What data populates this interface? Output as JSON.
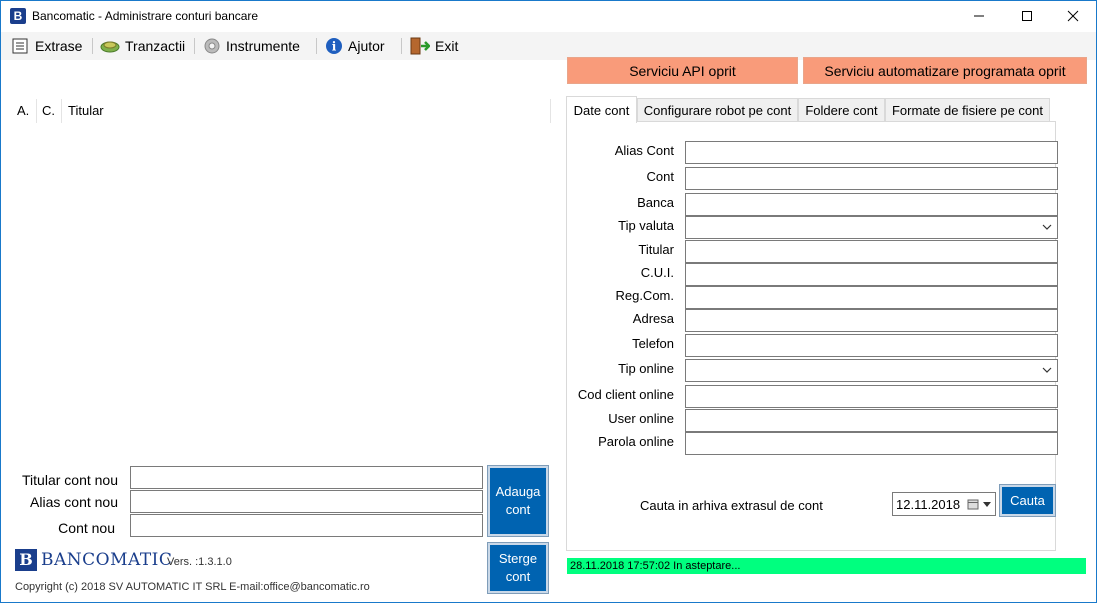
{
  "window": {
    "app_icon_letter": "B",
    "title": "Bancomatic - Administrare conturi bancare"
  },
  "menu": [
    {
      "label": "Extrase",
      "icon": "document-list-icon"
    },
    {
      "label": "Tranzactii",
      "icon": "money-exchange-icon"
    },
    {
      "label": "Instrumente",
      "icon": "gear-icon"
    },
    {
      "label": "Ajutor",
      "icon": "info-icon"
    },
    {
      "label": "Exit",
      "icon": "exit-door-icon"
    }
  ],
  "services": {
    "api": "Serviciu API oprit",
    "automation": "Serviciu automatizare programata oprit",
    "color": "#f99b7a"
  },
  "list_columns": [
    "A.",
    "C.",
    "Titular"
  ],
  "new_account": {
    "holder_label": "Titular cont nou",
    "alias_label": "Alias cont nou",
    "account_label": "Cont nou",
    "holder_value": "",
    "alias_value": "",
    "account_value": "",
    "add_button": "Adauga cont",
    "delete_button": "Sterge cont"
  },
  "tabs": [
    "Date cont",
    "Configurare robot pe cont",
    "Foldere cont",
    "Formate de fisiere pe cont"
  ],
  "fields": [
    {
      "label": "Alias Cont",
      "value": "",
      "type": "text"
    },
    {
      "label": "Cont",
      "value": "",
      "type": "text"
    },
    {
      "label": "Banca",
      "value": "",
      "type": "text"
    },
    {
      "label": "Tip valuta",
      "value": "",
      "type": "combo"
    },
    {
      "label": "Titular",
      "value": "",
      "type": "text"
    },
    {
      "label": "C.U.I.",
      "value": "",
      "type": "text"
    },
    {
      "label": "Reg.Com.",
      "value": "",
      "type": "text"
    },
    {
      "label": "Adresa",
      "value": "",
      "type": "text"
    },
    {
      "label": "Telefon",
      "value": "",
      "type": "text"
    },
    {
      "label": "Tip online",
      "value": "",
      "type": "combo"
    },
    {
      "label": "Cod client online",
      "value": "",
      "type": "text"
    },
    {
      "label": "User online",
      "value": "",
      "type": "text"
    },
    {
      "label": "Parola online",
      "value": "",
      "type": "text"
    }
  ],
  "search": {
    "label": "Cauta in arhiva extrasul de cont",
    "date": "12.11.2018",
    "button": "Cauta"
  },
  "status": {
    "text": "28.11.2018 17:57:02 In asteptare...",
    "color": "#00ff7f"
  },
  "brand": {
    "letter": "B",
    "name": "BANCOMATIC",
    "version": "Vers. :1.3.1.0",
    "copyright": "Copyright (c) 2018 SV AUTOMATIC IT SRL E-mail:office@bancomatic.ro"
  },
  "accent_color": "#0063b1"
}
